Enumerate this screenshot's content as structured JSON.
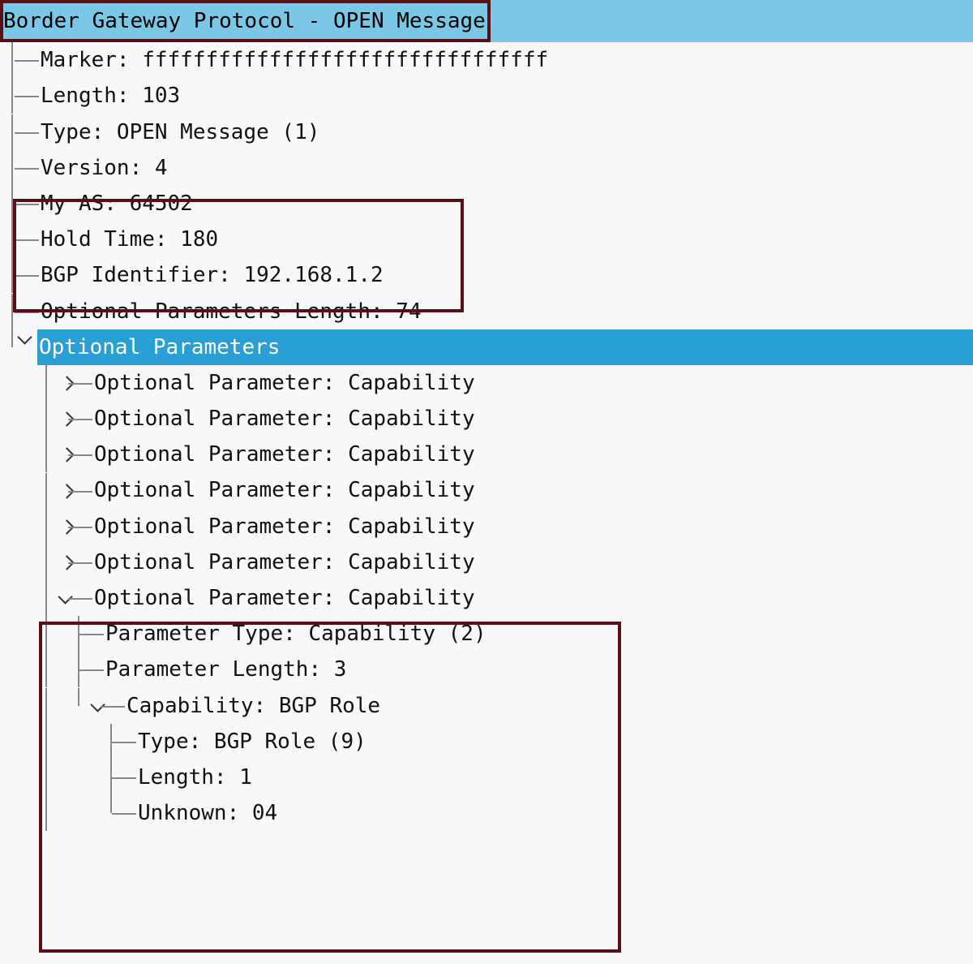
{
  "header": "Border Gateway Protocol - OPEN Message",
  "fields": {
    "marker": "Marker: ffffffffffffffffffffffffffffffff",
    "length": "Length: 103",
    "type": "Type: OPEN Message (1)",
    "version": "Version: 4",
    "myas": "My AS: 64502",
    "hold": "Hold Time: 180",
    "bgpid": "BGP Identifier: 192.168.1.2",
    "optlen": "Optional Parameters Length: 74",
    "optparams": "Optional Parameters"
  },
  "cap": "Optional Parameter: Capability",
  "capOpen": "Optional Parameter: Capability",
  "capDetail": {
    "ptype": "Parameter Type: Capability (2)",
    "plen": "Parameter Length: 3",
    "cap": "Capability: BGP Role",
    "t": "Type: BGP Role (9)",
    "l": "Length: 1",
    "u": "Unknown: 04"
  }
}
